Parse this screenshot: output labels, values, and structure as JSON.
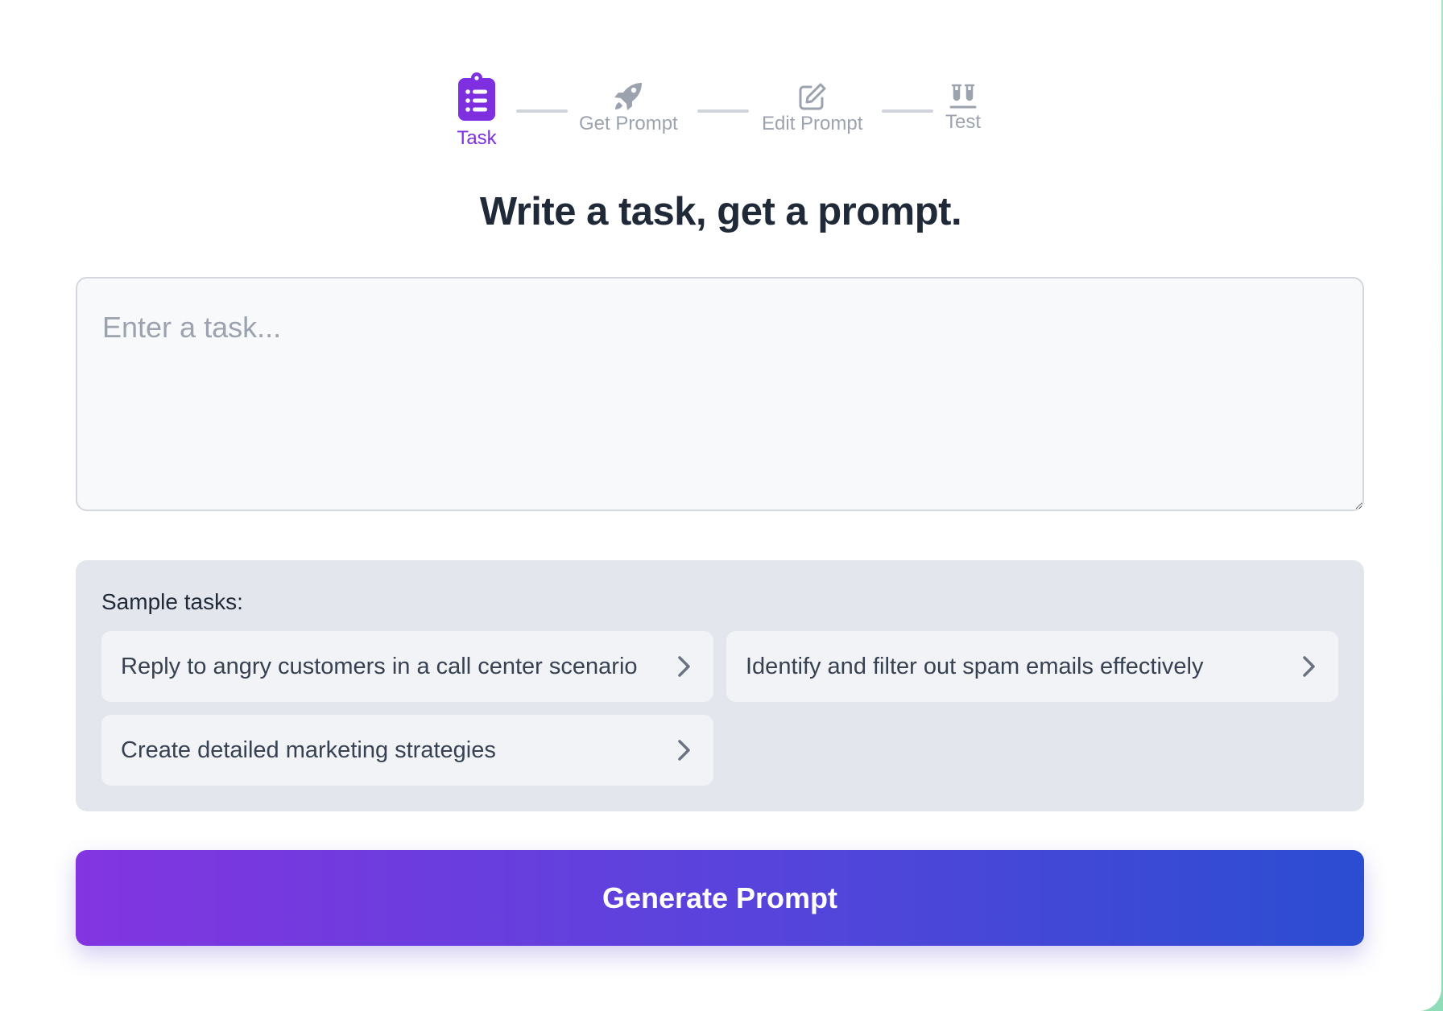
{
  "stepper": {
    "steps": [
      {
        "label": "Task",
        "icon": "clipboard-list-icon",
        "active": true
      },
      {
        "label": "Get Prompt",
        "icon": "rocket-icon",
        "active": false
      },
      {
        "label": "Edit Prompt",
        "icon": "edit-icon",
        "active": false
      },
      {
        "label": "Test",
        "icon": "test-tubes-icon",
        "active": false
      }
    ]
  },
  "heading": "Write a task, get a prompt.",
  "task_input": {
    "placeholder": "Enter a task...",
    "value": ""
  },
  "samples": {
    "title": "Sample tasks:",
    "items": [
      {
        "label": "Reply to angry customers in a call center scenario"
      },
      {
        "label": "Identify and filter out spam emails effectively"
      },
      {
        "label": "Create detailed marketing strategies"
      }
    ]
  },
  "generate_button": {
    "label": "Generate Prompt"
  },
  "colors": {
    "accent": "#7e2fe0",
    "inactive": "#9ca3af",
    "button_gradient_start": "#8235e0",
    "button_gradient_end": "#2b4dd1"
  }
}
